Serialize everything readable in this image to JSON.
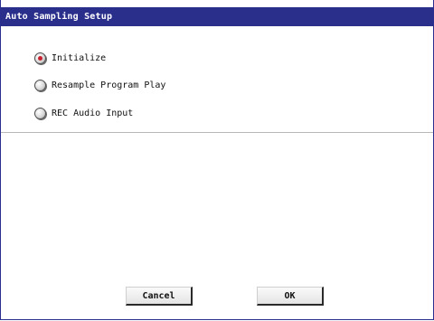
{
  "dialog": {
    "title": "Auto Sampling Setup"
  },
  "options": [
    {
      "label": "Initialize",
      "selected": true
    },
    {
      "label": "Resample Program Play",
      "selected": false
    },
    {
      "label": "REC Audio Input",
      "selected": false
    }
  ],
  "buttons": {
    "cancel_label": "Cancel",
    "ok_label": "OK"
  },
  "colors": {
    "title_bar": "#2b2f8c",
    "radio_selected_dot": "#c8202e"
  }
}
